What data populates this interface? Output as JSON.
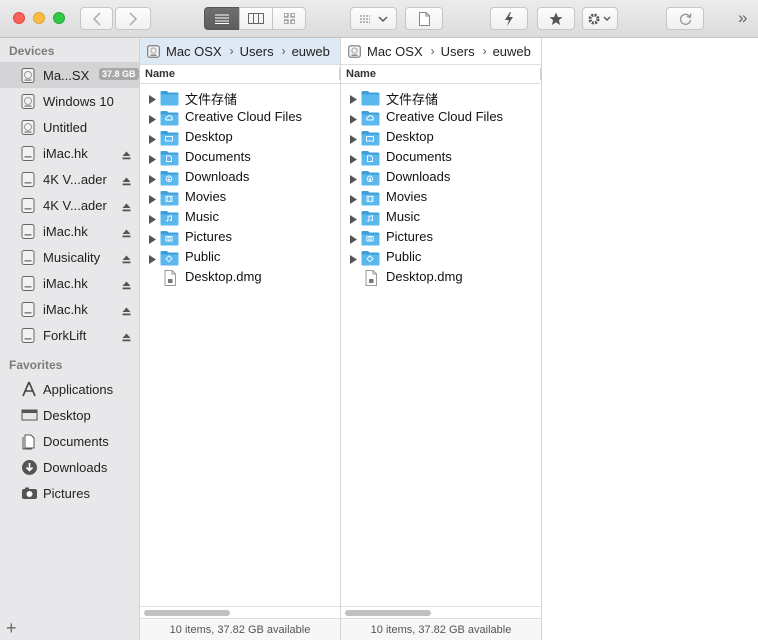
{
  "toolbar": {
    "icons": [
      "back-icon",
      "forward-icon",
      "list-view-icon",
      "column-view-icon",
      "icon-view-icon",
      "group-menu-icon",
      "file-icon",
      "sync-lightning-icon",
      "star-icon",
      "gear-menu-icon",
      "refresh-icon",
      "more-chevrons-icon"
    ],
    "more_label": "»"
  },
  "sidebar": {
    "devices_heading": "Devices",
    "favorites_heading": "Favorites",
    "devices": [
      {
        "label": "Ma...SX",
        "badge": "37.8 GB",
        "icon": "drive-icon",
        "selected": true,
        "eject": false
      },
      {
        "label": "Windows 10",
        "icon": "drive-icon",
        "eject": false
      },
      {
        "label": "Untitled",
        "icon": "drive-icon",
        "eject": false
      },
      {
        "label": "iMac.hk",
        "icon": "external-drive-icon",
        "eject": true
      },
      {
        "label": "4K V...ader",
        "icon": "external-drive-icon",
        "eject": true
      },
      {
        "label": "4K V...ader",
        "icon": "external-drive-icon",
        "eject": true
      },
      {
        "label": "iMac.hk",
        "icon": "external-drive-icon",
        "eject": true
      },
      {
        "label": "Musicality",
        "icon": "external-drive-icon",
        "eject": true
      },
      {
        "label": "iMac.hk",
        "icon": "external-drive-icon",
        "eject": true
      },
      {
        "label": "iMac.hk",
        "icon": "external-drive-icon",
        "eject": true
      },
      {
        "label": "ForkLift",
        "icon": "external-drive-icon",
        "eject": true
      }
    ],
    "favorites": [
      {
        "label": "Applications",
        "icon": "applications-icon"
      },
      {
        "label": "Desktop",
        "icon": "desktop-icon"
      },
      {
        "label": "Documents",
        "icon": "documents-icon"
      },
      {
        "label": "Downloads",
        "icon": "downloads-icon"
      },
      {
        "label": "Pictures",
        "icon": "pictures-icon"
      }
    ],
    "add_label": "+"
  },
  "left_pane": {
    "path": [
      "Mac OSX",
      "Users",
      "euweb"
    ],
    "sep": "›",
    "column_name": "Name",
    "status": "10 items, 37.82 GB available"
  },
  "right_pane": {
    "path": [
      "Mac OSX",
      "Users",
      "euweb"
    ],
    "sep": "›",
    "column_name": "Name",
    "status": "10 items, 37.82 GB available"
  },
  "files": [
    {
      "name": "文件存储",
      "type": "folder",
      "icon": "folder-icon"
    },
    {
      "name": "Creative Cloud Files",
      "type": "folder",
      "icon": "creative-cloud-folder-icon"
    },
    {
      "name": "Desktop",
      "type": "folder",
      "icon": "desktop-folder-icon"
    },
    {
      "name": "Documents",
      "type": "folder",
      "icon": "documents-folder-icon"
    },
    {
      "name": "Downloads",
      "type": "folder",
      "icon": "downloads-folder-icon"
    },
    {
      "name": "Movies",
      "type": "folder",
      "icon": "movies-folder-icon"
    },
    {
      "name": "Music",
      "type": "folder",
      "icon": "music-folder-icon"
    },
    {
      "name": "Pictures",
      "type": "folder",
      "icon": "pictures-folder-icon"
    },
    {
      "name": "Public",
      "type": "folder",
      "icon": "public-folder-icon"
    },
    {
      "name": "Desktop.dmg",
      "type": "file",
      "icon": "dmg-file-icon"
    }
  ],
  "colors": {
    "folder": "#5ab8ee",
    "folder_dark": "#3f9fd9",
    "selected_path": "#dfe8f5"
  }
}
